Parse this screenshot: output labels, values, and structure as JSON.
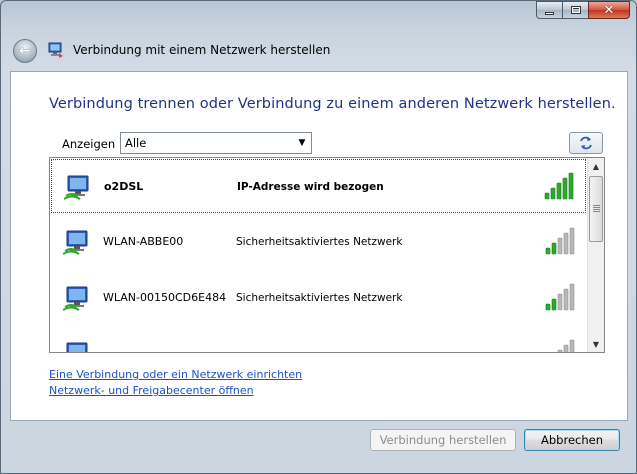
{
  "window": {
    "title": "Verbindung mit einem Netzwerk herstellen",
    "caption_buttons": {
      "minimize": "minimize-icon",
      "maximize": "maximize-icon",
      "close": "close-icon"
    }
  },
  "main": {
    "heading": "Verbindung trennen oder Verbindung zu einem anderen Netzwerk herstellen.",
    "show_label": "Anzeigen",
    "show_select": {
      "value": "Alle"
    }
  },
  "networks": [
    {
      "name": "o2DSL",
      "status": "IP-Adresse wird bezogen",
      "signal_bars_lit": 5,
      "signal_bars_total": 5,
      "selected": true
    },
    {
      "name": "WLAN-ABBE00",
      "status": "Sicherheitsaktiviertes Netzwerk",
      "signal_bars_lit": 2,
      "signal_bars_total": 5,
      "selected": false
    },
    {
      "name": "WLAN-00150CD6E484",
      "status": "Sicherheitsaktiviertes Netzwerk",
      "signal_bars_lit": 2,
      "signal_bars_total": 5,
      "selected": false
    }
  ],
  "links": {
    "setup": "Eine Verbindung oder ein Netzwerk einrichten",
    "network_center": "Netzwerk- und Freigabecenter öffnen"
  },
  "buttons": {
    "connect": "Verbindung herstellen",
    "cancel": "Abbrechen"
  },
  "colors": {
    "heading": "#1e3287",
    "link": "#1e50c8",
    "signal_on": "#2fa82f",
    "signal_off": "#b8b8b8"
  }
}
